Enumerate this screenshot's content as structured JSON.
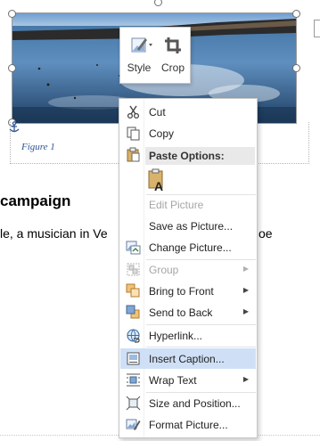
{
  "document": {
    "figure_caption": "Figure 1",
    "heading": "campaign",
    "body_text": "le, a musician in Ve",
    "body_text_tail": "oe"
  },
  "mini_toolbar": {
    "style_label": "Style",
    "crop_label": "Crop"
  },
  "context_menu": {
    "cut": "Cut",
    "copy": "Copy",
    "paste_options": "Paste Options:",
    "edit_picture": "Edit Picture",
    "save_as_picture": "Save as Picture...",
    "change_picture": "Change Picture...",
    "group": "Group",
    "bring_to_front": "Bring to Front",
    "send_to_back": "Send to Back",
    "hyperlink": "Hyperlink...",
    "insert_caption": "Insert Caption...",
    "wrap_text": "Wrap Text",
    "size_and_position": "Size and Position...",
    "format_picture": "Format Picture..."
  },
  "icons": {
    "cut": "scissors-icon",
    "copy": "copy-icon",
    "paste": "clipboard-icon",
    "change_picture": "change-picture-icon",
    "group": "group-icon",
    "bring_to_front": "bring-to-front-icon",
    "send_to_back": "send-to-back-icon",
    "hyperlink": "hyperlink-icon",
    "insert_caption": "insert-caption-icon",
    "wrap_text": "wrap-text-icon",
    "size_position": "size-position-icon",
    "format_picture": "format-picture-icon"
  },
  "colors": {
    "highlight": "#cfe0f6",
    "caption_blue": "#2f5597"
  }
}
